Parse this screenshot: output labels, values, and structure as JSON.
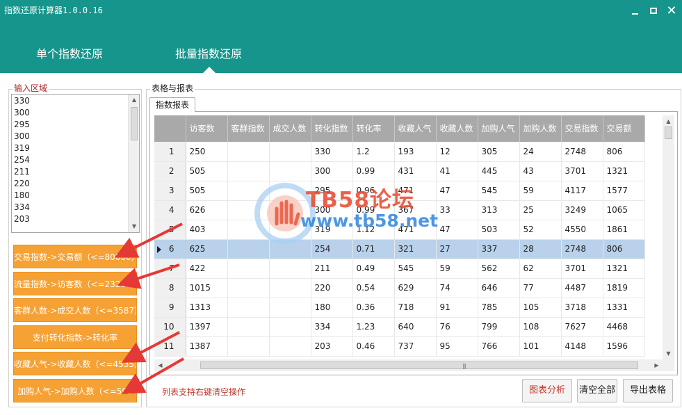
{
  "window": {
    "title": "指数还原计算器1.0.0.16",
    "minimize_glyph": "—",
    "maximize_glyph": "☐",
    "close_glyph": "✕"
  },
  "nav": {
    "tabs": [
      "单个指数还原",
      "批量指数还原"
    ],
    "active_tab": "批量指数还原"
  },
  "colors": {
    "header": "#15958b",
    "action_button": "#f6a133",
    "grid_header": "#a9a9a9",
    "selected_row": "#b9d1ea",
    "hint_red": "#c0392b"
  },
  "input_area": {
    "label": "输入区域",
    "values": [
      "330",
      "300",
      "295",
      "300",
      "319",
      "254",
      "211",
      "220",
      "180",
      "334",
      "203"
    ]
  },
  "actions": [
    "交易指数->交易额（<=80000）",
    "流量指数->访客数（<=23227）",
    "客群人数->成交人数（<=3587）",
    "支付转化指数->转化率",
    "收藏人气->收藏人数（<=4535）",
    "加购人气->加购人数（<=595"
  ],
  "report": {
    "label": "表格与报表",
    "tab": "指数报表",
    "columns": [
      "访客数",
      "客群指数",
      "成交人数",
      "转化指数",
      "转化率",
      "收藏人气",
      "收藏人数",
      "加购人气",
      "加购人数",
      "交易指数",
      "交易额"
    ],
    "rows": [
      [
        "1",
        "250",
        "",
        "",
        "330",
        "1.2",
        "193",
        "12",
        "305",
        "24",
        "2748",
        "806"
      ],
      [
        "2",
        "505",
        "",
        "",
        "300",
        "0.99",
        "431",
        "41",
        "445",
        "43",
        "3701",
        "1321"
      ],
      [
        "3",
        "505",
        "",
        "",
        "295",
        "0.96",
        "471",
        "47",
        "545",
        "59",
        "4117",
        "1577"
      ],
      [
        "4",
        "626",
        "",
        "",
        "300",
        "0.99",
        "367",
        "33",
        "313",
        "25",
        "3249",
        "1065"
      ],
      [
        "5",
        "403",
        "",
        "",
        "319",
        "1.12",
        "471",
        "47",
        "503",
        "52",
        "4550",
        "1861"
      ],
      [
        "6",
        "625",
        "",
        "",
        "254",
        "0.71",
        "321",
        "27",
        "337",
        "28",
        "2748",
        "806"
      ],
      [
        "7",
        "422",
        "",
        "",
        "211",
        "0.49",
        "545",
        "59",
        "562",
        "62",
        "3701",
        "1321"
      ],
      [
        "8",
        "1015",
        "",
        "",
        "220",
        "0.54",
        "629",
        "74",
        "646",
        "77",
        "4487",
        "1819"
      ],
      [
        "9",
        "1313",
        "",
        "",
        "180",
        "0.36",
        "718",
        "91",
        "785",
        "105",
        "3718",
        "1331"
      ],
      [
        "10",
        "1397",
        "",
        "",
        "334",
        "1.23",
        "640",
        "76",
        "799",
        "108",
        "7627",
        "4468"
      ],
      [
        "11",
        "1387",
        "",
        "",
        "203",
        "0.46",
        "737",
        "95",
        "766",
        "101",
        "4148",
        "1596"
      ]
    ],
    "selected_row": "6"
  },
  "footer": {
    "hint": "列表支持右键清空操作",
    "chart_button": "图表分析",
    "clear_button": "清空全部",
    "export_button": "导出表格"
  },
  "watermark": {
    "title": "TB58论坛",
    "url": "www.tb58.net"
  }
}
